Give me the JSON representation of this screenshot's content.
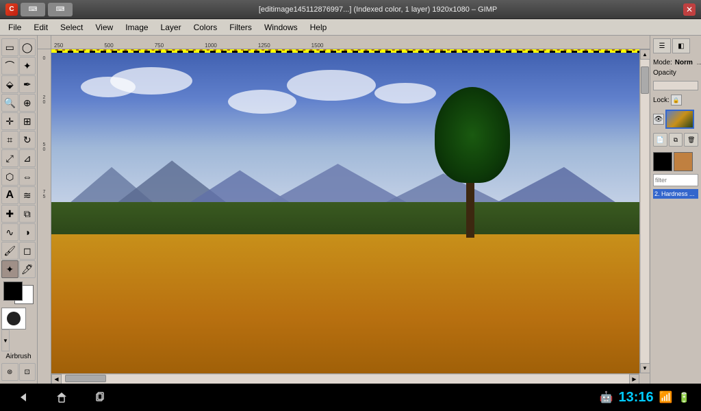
{
  "titlebar": {
    "title": "[editimage145112876997...] (Indexed color, 1 layer) 1920x1080 – GIMP",
    "close_label": "✕",
    "icon_label": "C"
  },
  "menubar": {
    "items": [
      "File",
      "Edit",
      "Select",
      "View",
      "Image",
      "Layer",
      "Colors",
      "Filters",
      "Windows",
      "Help"
    ]
  },
  "toolbar": {
    "tools": [
      {
        "name": "rectangle-select",
        "icon": "▭"
      },
      {
        "name": "ellipse-select",
        "icon": "◯"
      },
      {
        "name": "free-select",
        "icon": "⌘"
      },
      {
        "name": "fuzzy-select",
        "icon": "✦"
      },
      {
        "name": "crop",
        "icon": "⌗"
      },
      {
        "name": "rotate",
        "icon": "↻"
      },
      {
        "name": "scale",
        "icon": "⤢"
      },
      {
        "name": "shear",
        "icon": "⊿"
      },
      {
        "name": "perspective",
        "icon": "⬡"
      },
      {
        "name": "flip",
        "icon": "⇔"
      },
      {
        "name": "text",
        "icon": "A"
      },
      {
        "name": "color-picker",
        "icon": "✒"
      },
      {
        "name": "zoom",
        "icon": "🔍"
      },
      {
        "name": "measure",
        "icon": "⊕"
      },
      {
        "name": "move",
        "icon": "✛"
      },
      {
        "name": "align",
        "icon": "⊞"
      },
      {
        "name": "bucket-fill",
        "icon": "🪣"
      },
      {
        "name": "blend",
        "icon": "◩"
      },
      {
        "name": "pencil",
        "icon": "✏"
      },
      {
        "name": "paintbrush",
        "icon": "🖌"
      },
      {
        "name": "eraser",
        "icon": "◻"
      },
      {
        "name": "airbrush",
        "icon": "✦"
      },
      {
        "name": "smudge",
        "icon": "∿"
      },
      {
        "name": "clone",
        "icon": "⧉"
      },
      {
        "name": "healing",
        "icon": "✚"
      },
      {
        "name": "dodge-burn",
        "icon": "◑"
      },
      {
        "name": "path",
        "icon": "⬙"
      },
      {
        "name": "ink",
        "icon": "🖊"
      }
    ],
    "airbrush_label": "Airbrush"
  },
  "ruler": {
    "top_marks": [
      "250",
      "500",
      "750",
      "1000",
      "1250",
      "1500"
    ],
    "left_marks": [
      "0",
      "2",
      "5",
      "7"
    ]
  },
  "layers_panel": {
    "mode_label": "Mode:",
    "mode_value": "Norm",
    "opacity_label": "Opacity",
    "lock_label": "Lock:",
    "filter_placeholder": "filter",
    "layer_name": "2. Hardness ...",
    "panel_buttons": [
      "new",
      "duplicate",
      "delete"
    ]
  },
  "swatches": {
    "fg_color": "#000000",
    "bg_color": "#ffffff",
    "swatch1": "#000000",
    "swatch2": "#c08040"
  },
  "statusbar": {
    "time": "13:16",
    "nav": [
      "back",
      "home",
      "recent"
    ]
  }
}
